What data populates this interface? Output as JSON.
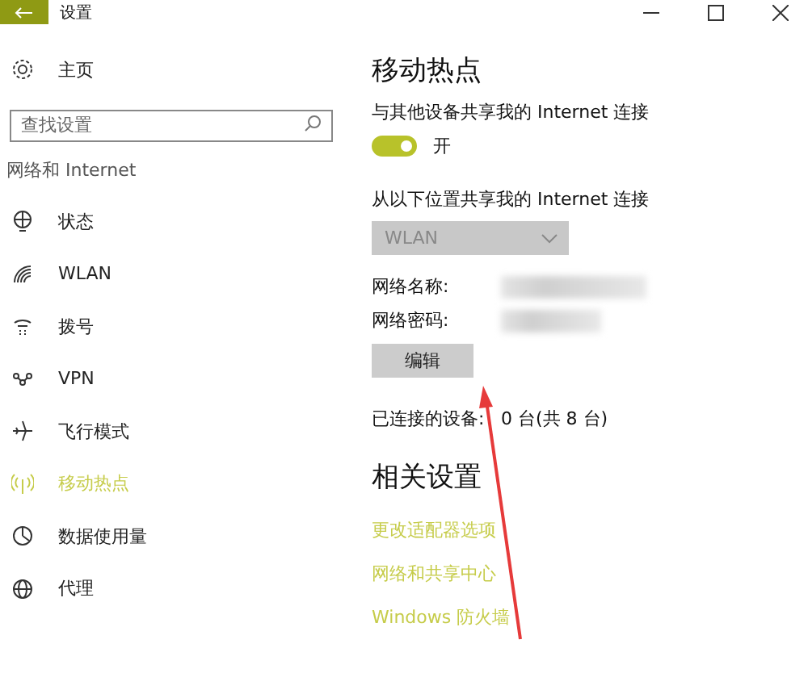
{
  "window": {
    "title": "设置"
  },
  "sidebar": {
    "home": "主页",
    "search": {
      "placeholder": "查找设置"
    },
    "section": "网络和 Internet",
    "items": [
      {
        "label": "状态",
        "selected": false
      },
      {
        "label": "WLAN",
        "selected": false
      },
      {
        "label": "拨号",
        "selected": false
      },
      {
        "label": "VPN",
        "selected": false
      },
      {
        "label": "飞行模式",
        "selected": false
      },
      {
        "label": "移动热点",
        "selected": true
      },
      {
        "label": "数据使用量",
        "selected": false
      },
      {
        "label": "代理",
        "selected": false
      }
    ]
  },
  "content": {
    "title": "移动热点",
    "share_label": "与其他设备共享我的 Internet 连接",
    "toggle": {
      "on": true,
      "label": "开"
    },
    "source_label": "从以下位置共享我的 Internet 连接",
    "source": {
      "value": "WLAN",
      "disabled": true
    },
    "network_name_label": "网络名称:",
    "network_password_label": "网络密码:",
    "edit_button": "编辑",
    "connected_label": "已连接的设备:",
    "connected_value": "0 台(共 8 台)",
    "related_title": "相关设置",
    "links": [
      "更改适配器选项",
      "网络和共享中心",
      "Windows 防火墙"
    ]
  }
}
